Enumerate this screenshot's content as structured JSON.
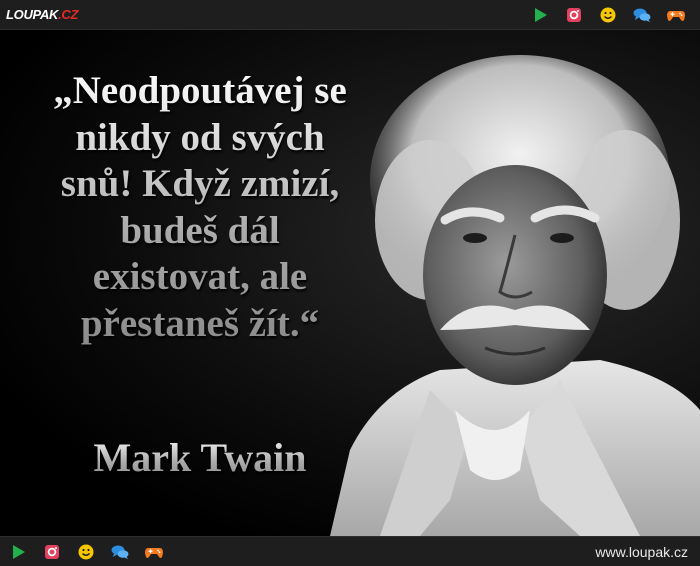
{
  "header": {
    "logo_main": "LOUPAK",
    "logo_tld": ".CZ",
    "icons": [
      "play-icon",
      "instagram-icon",
      "smiley-icon",
      "chat-icon",
      "gamepad-icon"
    ]
  },
  "quote": {
    "lines": [
      "„Neodpoutávej se",
      "nikdy od svých",
      "snů! Když zmizí,",
      "budeš dál",
      "existovat, ale",
      "přestaneš žít.“"
    ],
    "author": "Mark Twain"
  },
  "footer": {
    "site_url": "www.loupak.cz",
    "icons": [
      "play-icon",
      "instagram-icon",
      "smiley-icon",
      "chat-icon",
      "gamepad-icon"
    ]
  },
  "colors": {
    "play": "#22b14c",
    "instagram": "#e4405f",
    "smiley": "#f7c600",
    "chat": "#2d8ee0",
    "gamepad": "#f47a20",
    "logo_tld": "#e32b26"
  }
}
